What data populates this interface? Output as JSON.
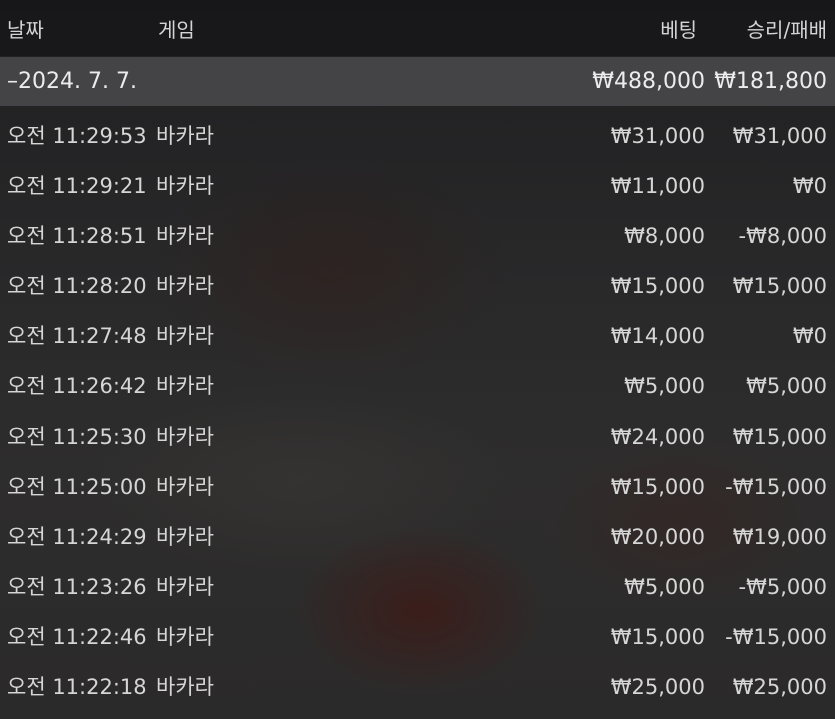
{
  "header": {
    "date_label": "날짜",
    "game_label": "게임",
    "bet_label": "베팅",
    "result_label": "승리/패배"
  },
  "summary": {
    "date": "–2024. 7. 7.",
    "bet_total": "₩488,000",
    "result_total": "₩181,800"
  },
  "rows": [
    {
      "time": "오전 11:29:53",
      "game": "바카라",
      "bet": "₩31,000",
      "result": "₩31,000"
    },
    {
      "time": "오전 11:29:21",
      "game": "바카라",
      "bet": "₩11,000",
      "result": "₩0"
    },
    {
      "time": "오전 11:28:51",
      "game": "바카라",
      "bet": "₩8,000",
      "result": "-₩8,000"
    },
    {
      "time": "오전 11:28:20",
      "game": "바카라",
      "bet": "₩15,000",
      "result": "₩15,000"
    },
    {
      "time": "오전 11:27:48",
      "game": "바카라",
      "bet": "₩14,000",
      "result": "₩0"
    },
    {
      "time": "오전 11:26:42",
      "game": "바카라",
      "bet": "₩5,000",
      "result": "₩5,000"
    },
    {
      "time": "오전 11:25:30",
      "game": "바카라",
      "bet": "₩24,000",
      "result": "₩15,000"
    },
    {
      "time": "오전 11:25:00",
      "game": "바카라",
      "bet": "₩15,000",
      "result": "-₩15,000"
    },
    {
      "time": "오전 11:24:29",
      "game": "바카라",
      "bet": "₩20,000",
      "result": "₩19,000"
    },
    {
      "time": "오전 11:23:26",
      "game": "바카라",
      "bet": "₩5,000",
      "result": "-₩5,000"
    },
    {
      "time": "오전 11:22:46",
      "game": "바카라",
      "bet": "₩15,000",
      "result": "-₩15,000"
    },
    {
      "time": "오전 11:22:18",
      "game": "바카라",
      "bet": "₩25,000",
      "result": "₩25,000"
    }
  ]
}
